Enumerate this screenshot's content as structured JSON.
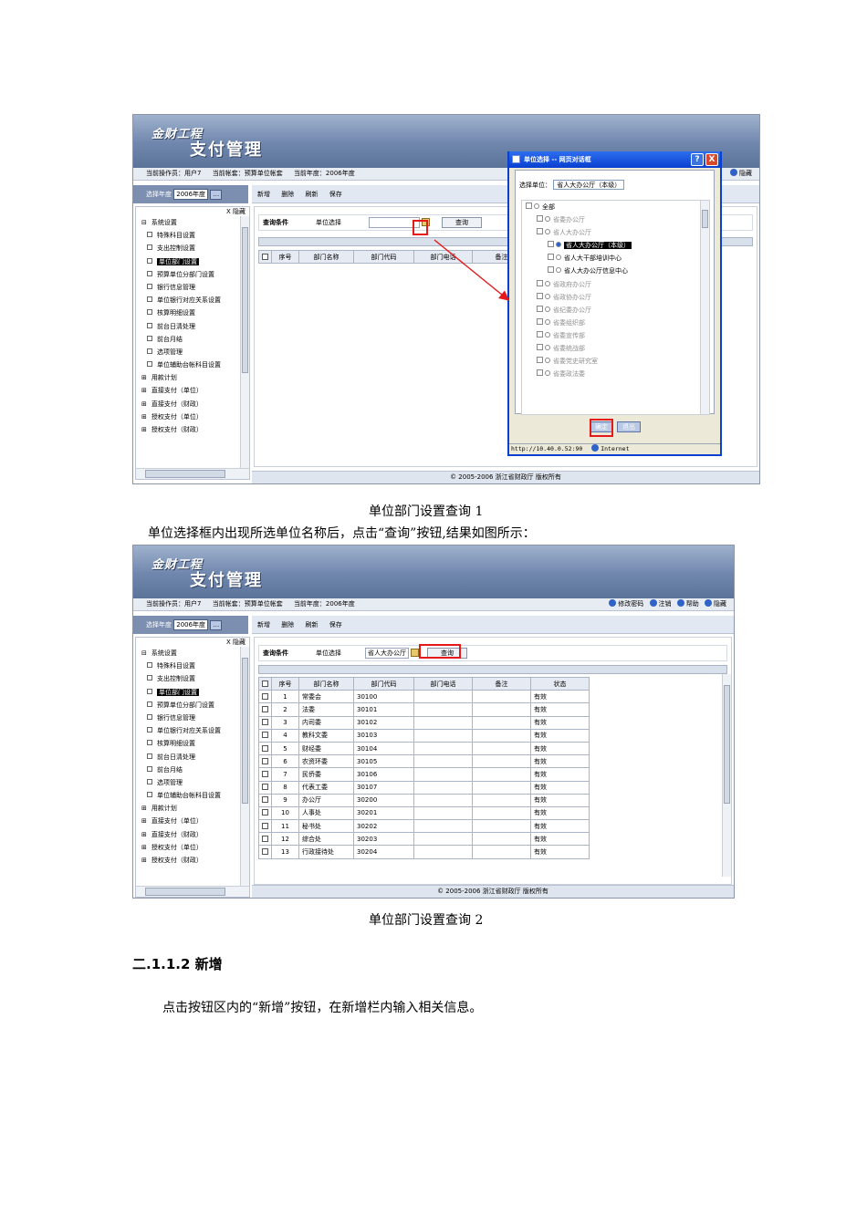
{
  "app": {
    "logo_line1": "金财工程",
    "logo_line2": "支付管理",
    "operator": "当前操作员：用户7",
    "account": "当前帐套：预算单位帐套",
    "year_info": "当前年度：2006年度",
    "year_label": "选择年度",
    "year_value": "2006年度",
    "year_btn": "…",
    "links": {
      "change_pwd": "修改密码",
      "logout": "注销",
      "help": "帮助",
      "hide": "隐藏"
    },
    "toolbar": {
      "add": "新增",
      "delete": "删除",
      "refresh": "刷新",
      "save": "保存"
    },
    "sidebar_hide": "X 隐藏",
    "footer": "© 2005-2006 浙江省财政厅 版权所有"
  },
  "sidebar": [
    {
      "label": "系统设置",
      "level": 1,
      "mark": "⊟"
    },
    {
      "label": "特殊科目设置",
      "level": 2
    },
    {
      "label": "支出控制设置",
      "level": 2
    },
    {
      "label": "单位部门设置",
      "level": 2,
      "selected": true
    },
    {
      "label": "预算单位分部门设置",
      "level": 2
    },
    {
      "label": "银行信息管理",
      "level": 2
    },
    {
      "label": "单位银行对应关系设置",
      "level": 2
    },
    {
      "label": "核算明细设置",
      "level": 2
    },
    {
      "label": "前台日清处理",
      "level": 2
    },
    {
      "label": "前台月结",
      "level": 2
    },
    {
      "label": "选项管理",
      "level": 2
    },
    {
      "label": "单位辅助台帐科目设置",
      "level": 2
    },
    {
      "label": "用款计划",
      "level": 1,
      "mark": "⊞"
    },
    {
      "label": "直接支付（单位）",
      "level": 1,
      "mark": "⊞"
    },
    {
      "label": "直接支付（财政）",
      "level": 1,
      "mark": "⊞"
    },
    {
      "label": "授权支付（单位）",
      "level": 1,
      "mark": "⊞"
    },
    {
      "label": "授权支付（财政）",
      "level": 1,
      "mark": "⊞"
    }
  ],
  "query": {
    "label": "查询条件",
    "unit_label": "单位选择",
    "unit_value_2": "省人大办公厅",
    "button": "查询"
  },
  "grid": {
    "headers": [
      "序号",
      "部门名称",
      "部门代码",
      "部门电话",
      "备注",
      "状态"
    ],
    "rows": [
      [
        "1",
        "常委会",
        "30100",
        "",
        "",
        "有效"
      ],
      [
        "2",
        "法委",
        "30101",
        "",
        "",
        "有效"
      ],
      [
        "3",
        "内司委",
        "30102",
        "",
        "",
        "有效"
      ],
      [
        "4",
        "教科文委",
        "30103",
        "",
        "",
        "有效"
      ],
      [
        "5",
        "财经委",
        "30104",
        "",
        "",
        "有效"
      ],
      [
        "6",
        "农资环委",
        "30105",
        "",
        "",
        "有效"
      ],
      [
        "7",
        "民侨委",
        "30106",
        "",
        "",
        "有效"
      ],
      [
        "8",
        "代表工委",
        "30107",
        "",
        "",
        "有效"
      ],
      [
        "9",
        "办公厅",
        "30200",
        "",
        "",
        "有效"
      ],
      [
        "10",
        "人事处",
        "30201",
        "",
        "",
        "有效"
      ],
      [
        "11",
        "秘书处",
        "30202",
        "",
        "",
        "有效"
      ],
      [
        "12",
        "综合处",
        "30203",
        "",
        "",
        "有效"
      ],
      [
        "13",
        "行政接待处",
        "30204",
        "",
        "",
        "有效"
      ]
    ]
  },
  "dialog": {
    "title": "单位选择 -- 网页对话框",
    "help_btn": "?",
    "close_btn": "X",
    "select_label": "选择单位：",
    "select_value": "省人大办公厅（本级）",
    "tree": [
      {
        "label": "全部",
        "indent": 0,
        "mark": "⊟",
        "gray": false
      },
      {
        "label": "省委办公厅",
        "indent": 1,
        "mark": "⊞",
        "gray": true
      },
      {
        "label": "省人大办公厅",
        "indent": 1,
        "mark": "⊟",
        "gray": true
      },
      {
        "label": "省人大办公厅（本级）",
        "indent": 2,
        "mark": "□",
        "gray": false,
        "selected": true
      },
      {
        "label": "省人大干部培训中心",
        "indent": 2,
        "mark": "□",
        "gray": false
      },
      {
        "label": "省人大办公厅信息中心",
        "indent": 2,
        "mark": "□",
        "gray": false
      },
      {
        "label": "省政府办公厅",
        "indent": 1,
        "mark": "⊞",
        "gray": true
      },
      {
        "label": "省政协办公厅",
        "indent": 1,
        "mark": "⊞",
        "gray": true
      },
      {
        "label": "省纪委办公厅",
        "indent": 1,
        "mark": "⊞",
        "gray": true
      },
      {
        "label": "省委组织部",
        "indent": 1,
        "mark": "⊞",
        "gray": true
      },
      {
        "label": "省委宣传部",
        "indent": 1,
        "mark": "⊞",
        "gray": true
      },
      {
        "label": "省委统战部",
        "indent": 1,
        "mark": "⊞",
        "gray": true
      },
      {
        "label": "省委党史研究室",
        "indent": 1,
        "mark": "⊞",
        "gray": true
      },
      {
        "label": "省委政法委",
        "indent": 1,
        "mark": "⊞",
        "gray": true
      }
    ],
    "ok_btn": "确定",
    "cancel_btn": "退出",
    "status_url": "http://10.40.0.52:90",
    "status_zone": "Internet"
  },
  "captions": {
    "cap1": "单位部门设置查询 1",
    "text1": "单位选择框内出现所选单位名称后，点击“查询”按钮,结果如图所示：",
    "cap2": "单位部门设置查询 2",
    "heading": "二.1.1.2 新增",
    "para": "点击按钮区内的“新增”按钮，在新增栏内输入相关信息。"
  }
}
